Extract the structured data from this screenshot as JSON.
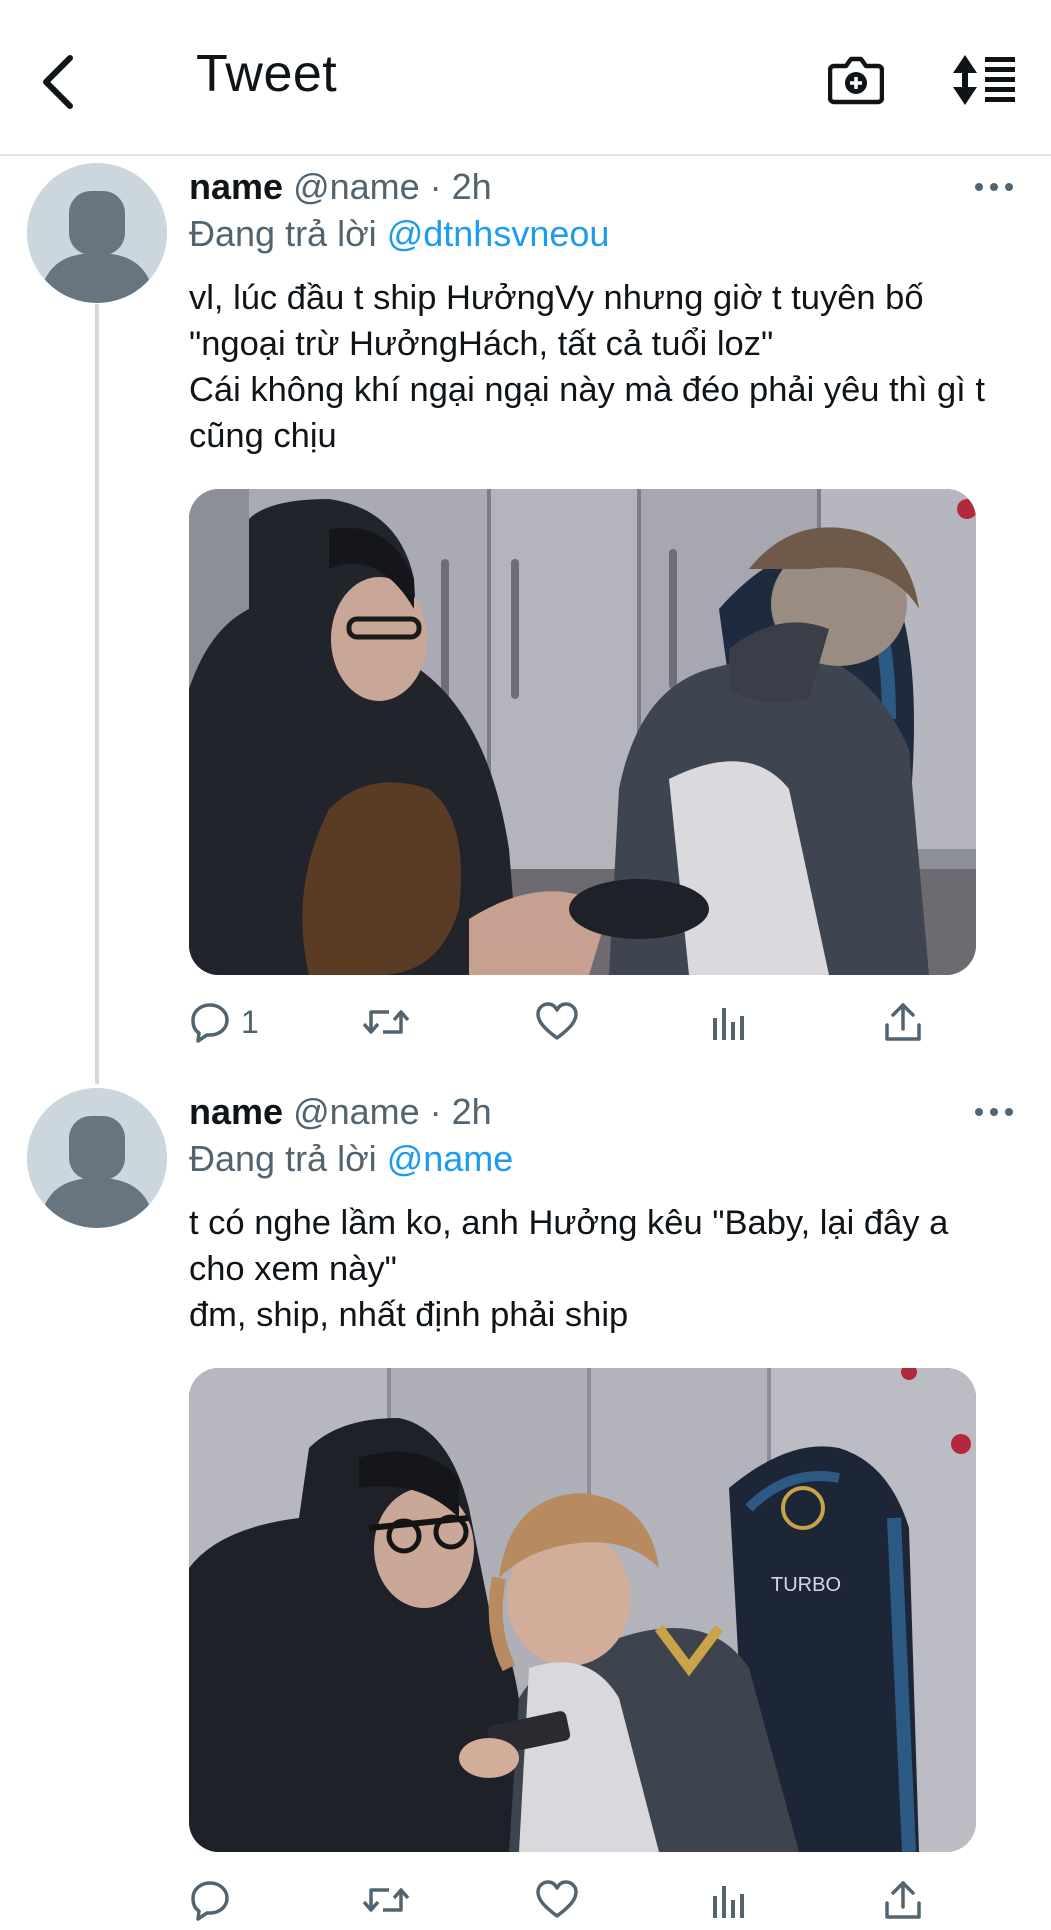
{
  "header": {
    "title": "Tweet"
  },
  "tweets": [
    {
      "name": "name",
      "handle": "@name · 2h",
      "reply_prefix": "Đang trả lời",
      "reply_mention": "@dtnhsvneou",
      "text": "vl, lúc đầu t ship HưởngVy nhưng giờ t tuyên bố \"ngoại trừ HưởngHách, tất cả tuổi loz\"\nCái không khí ngại ngại này mà đéo phải yêu thì gì t cũng chịu",
      "replies": "1"
    },
    {
      "name": "name",
      "handle": "@name · 2h",
      "reply_prefix": "Đang trả lời",
      "reply_mention": "@name",
      "text": "t có nghe lầm ko, anh Hưởng kêu \"Baby, lại đây a cho xem này\"\nđm, ship, nhất định phải ship",
      "chair_text": "TURBO"
    }
  ],
  "icons": {
    "back": "chevron-left-icon",
    "camera": "camera-plus-icon",
    "sort": "sort-icon",
    "more": "more-dots-icon",
    "reply": "reply-icon",
    "retweet": "retweet-icon",
    "like": "heart-icon",
    "analytics": "analytics-icon",
    "share": "share-icon"
  },
  "colors": {
    "link": "#1d9bf0",
    "muted": "#536471",
    "text": "#0f1419",
    "avatar_bg": "#ccd6dd",
    "avatar_fg": "#66757f",
    "divider": "#dfe3e6"
  }
}
